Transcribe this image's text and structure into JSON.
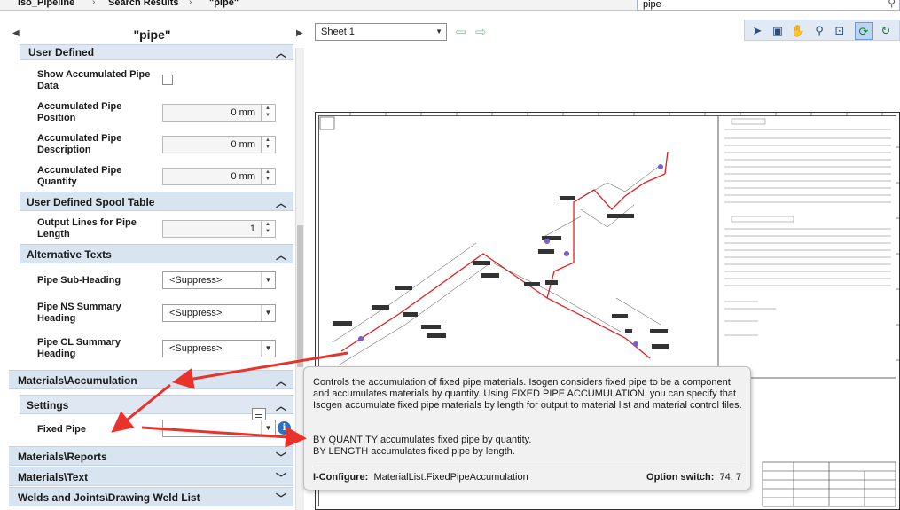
{
  "breadcrumb": {
    "items": [
      "Iso_Pipeline",
      "Search Results",
      "\"pipe\""
    ],
    "separator": "›"
  },
  "search": {
    "value": "pipe",
    "icon": "search-icon"
  },
  "panel": {
    "title": "\"pipe\"",
    "sections": {
      "user_defined": "User Defined",
      "user_defined_spool_table": "User Defined Spool Table",
      "alternative_texts": "Alternative Texts",
      "materials_accumulation": "Materials\\Accumulation",
      "settings": "Settings",
      "materials_reports": "Materials\\Reports",
      "materials_text": "Materials\\Text",
      "welds_and_joints": "Welds and Joints\\Drawing Weld List"
    },
    "rows": {
      "show_accum": {
        "label": "Show Accumulated Pipe Data"
      },
      "accum_position": {
        "label": "Accumulated Pipe Position",
        "value": "0 mm"
      },
      "accum_description": {
        "label": "Accumulated Pipe Description",
        "value": "0 mm"
      },
      "accum_quantity": {
        "label": "Accumulated Pipe Quantity",
        "value": "0 mm"
      },
      "output_lines": {
        "label": "Output Lines for Pipe Length",
        "value": "1"
      },
      "pipe_sub_heading": {
        "label": "Pipe Sub-Heading",
        "value": "<Suppress>"
      },
      "pipe_ns_summary": {
        "label": "Pipe NS Summary Heading",
        "value": "<Suppress>"
      },
      "pipe_cl_summary": {
        "label": "Pipe CL Summary Heading",
        "value": "<Suppress>"
      },
      "fixed_pipe": {
        "label": "Fixed Pipe",
        "value": ""
      }
    }
  },
  "viewer": {
    "sheet": "Sheet 1",
    "tools": [
      "select-pointer-icon",
      "fit-view-icon",
      "pan-hand-icon",
      "zoom-icon",
      "zoom-window-icon",
      "refresh-sync-icon",
      "reload-icon"
    ]
  },
  "tooltip": {
    "description": "Controls the accumulation of fixed pipe materials. Isogen considers fixed pipe to be a component and accumulates materials by quantity. Using FIXED PIPE ACCUMULATION, you can specify that Isogen accumulate fixed pipe materials by length for output to material list and material control files.",
    "option1": "BY QUANTITY accumulates fixed pipe by quantity.",
    "option2": "BY LENGTH accumulates fixed pipe by length.",
    "iconfigure_label": "I-Configure:",
    "iconfigure_value": "MaterialList.FixedPipeAccumulation",
    "option_switch_label": "Option switch:",
    "option_switch_value": "74, 7"
  },
  "colors": {
    "section_bg": "#d8e4f0",
    "annotation_arrow": "#e8322b",
    "pipe_line": "#e02020",
    "info_button": "#2e6fc0"
  }
}
